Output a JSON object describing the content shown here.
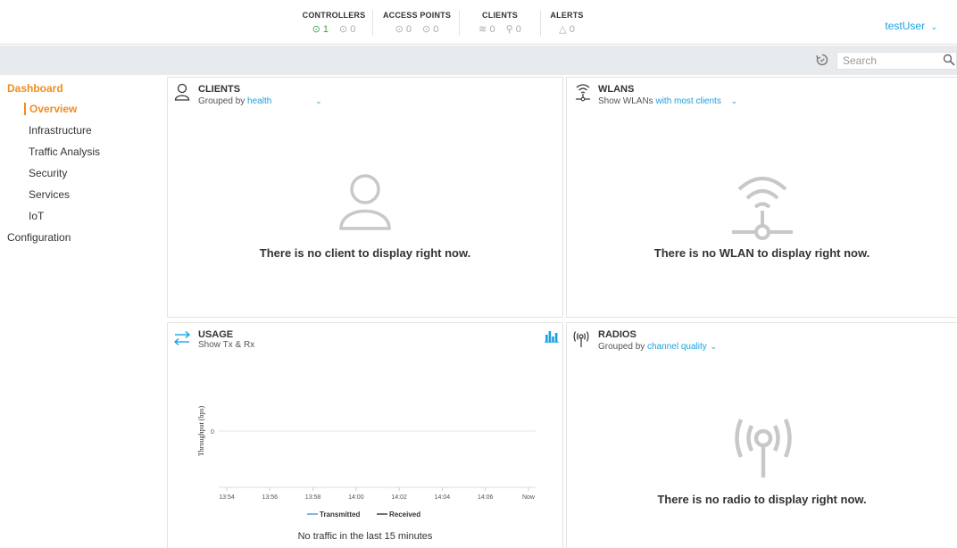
{
  "header": {
    "groups": [
      {
        "title": "CONTROLLERS",
        "items": [
          {
            "icon": "check-circle-icon",
            "value": "1",
            "ok": true
          },
          {
            "icon": "clock-circle-icon",
            "value": "0",
            "ok": false
          }
        ]
      },
      {
        "title": "ACCESS POINTS",
        "items": [
          {
            "icon": "check-circle-icon",
            "value": "0",
            "ok": false
          },
          {
            "icon": "clock-circle-icon",
            "value": "0",
            "ok": false
          }
        ]
      },
      {
        "title": "CLIENTS",
        "items": [
          {
            "icon": "wifi-icon",
            "value": "0",
            "ok": false
          },
          {
            "icon": "wired-icon",
            "value": "0",
            "ok": false
          }
        ]
      },
      {
        "title": "ALERTS",
        "items": [
          {
            "icon": "warning-icon",
            "value": "0",
            "ok": false
          }
        ]
      }
    ],
    "user": "testUser"
  },
  "toolbar": {
    "search_placeholder": "Search"
  },
  "sidebar": {
    "dashboard": "Dashboard",
    "items": [
      "Overview",
      "Infrastructure",
      "Traffic Analysis",
      "Security",
      "Services",
      "IoT"
    ],
    "configuration": "Configuration"
  },
  "clients_panel": {
    "title": "CLIENTS",
    "sub_prefix": "Grouped by",
    "sub_value": "health",
    "empty": "There is no client to display right now."
  },
  "wlans_panel": {
    "title": "WLANS",
    "sub_prefix": "Show WLANs",
    "sub_value": "with most clients",
    "empty": "There is no WLAN to display right now."
  },
  "usage_panel": {
    "title": "USAGE",
    "sub": "Show Tx & Rx",
    "y_label": "Throughput (bps)",
    "y_tick": "0",
    "x_ticks": [
      "13:54",
      "13:56",
      "13:58",
      "14:00",
      "14:02",
      "14:04",
      "14:06",
      "Now"
    ],
    "legend": [
      "Transmitted",
      "Received"
    ],
    "empty": "No traffic in the last 15 minutes"
  },
  "radios_panel": {
    "title": "RADIOS",
    "sub_prefix": "Grouped by",
    "sub_value": "channel quality",
    "empty": "There is no radio to display right now."
  },
  "colors": {
    "accent": "#f28c1e",
    "link": "#1aa2e0",
    "ok": "#3aa245",
    "icon_gray": "#c8c8c8"
  }
}
